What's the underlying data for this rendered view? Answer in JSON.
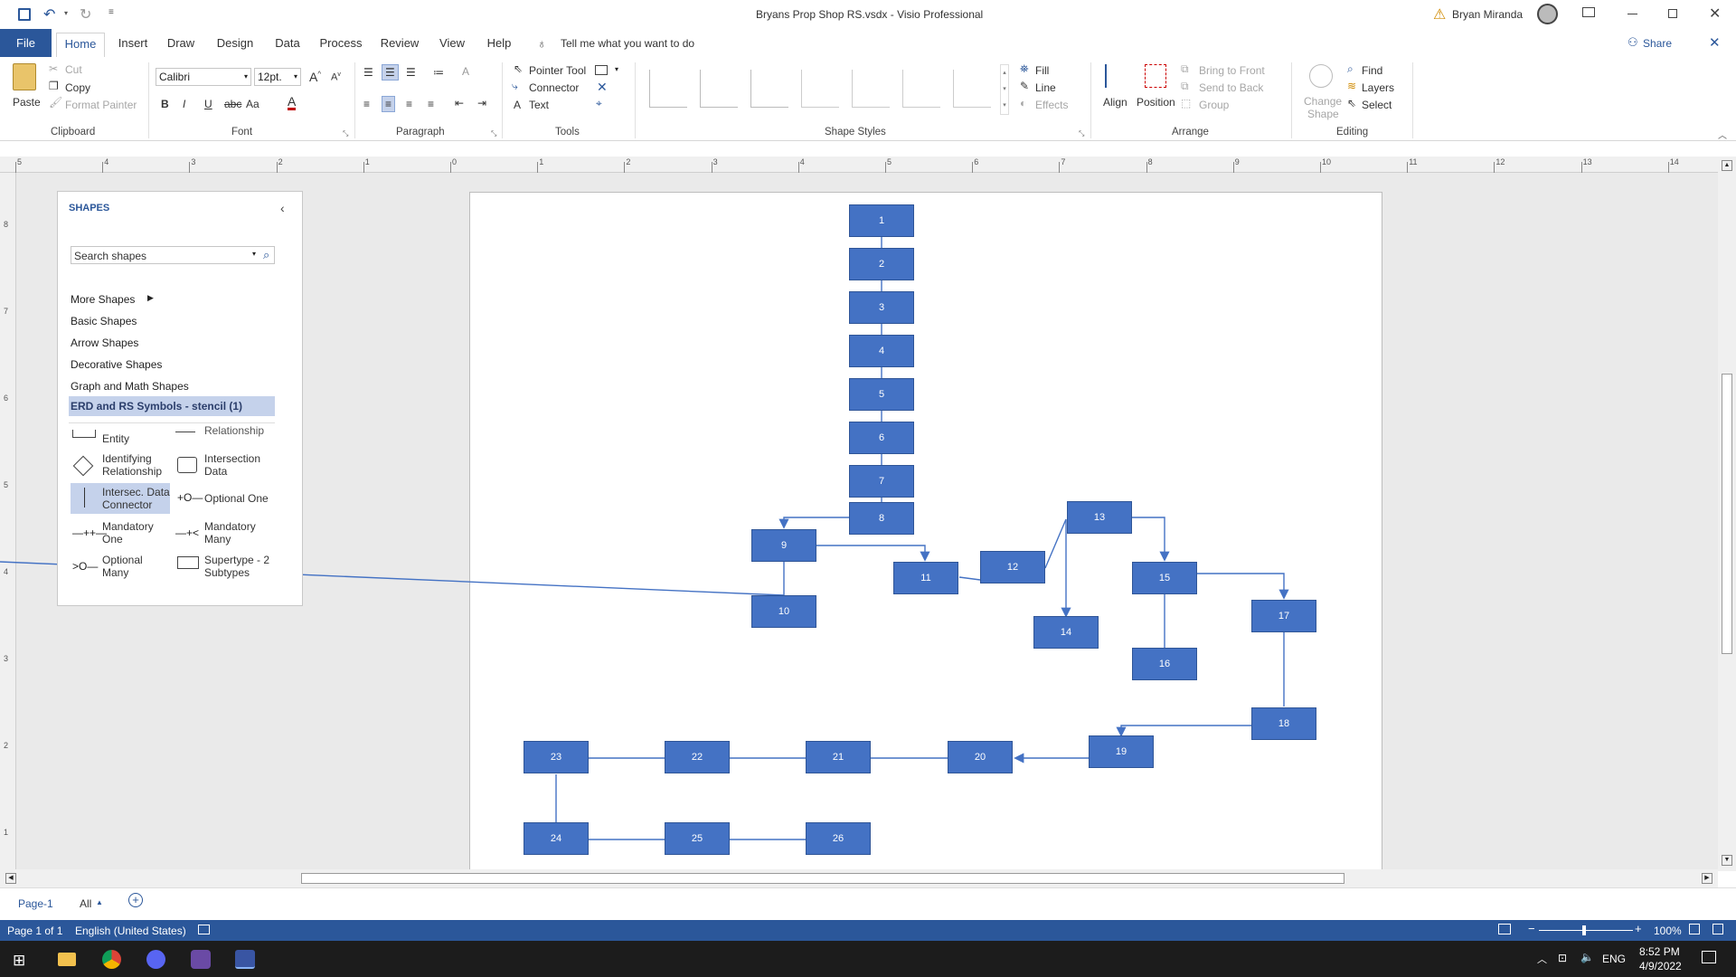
{
  "window": {
    "title": "Bryans Prop Shop RS.vsdx  -  Visio Professional",
    "user": "Bryan Miranda",
    "share": "Share",
    "tell_me": "Tell me what you want to do"
  },
  "tabs": [
    "File",
    "Home",
    "Insert",
    "Draw",
    "Design",
    "Data",
    "Process",
    "Review",
    "View",
    "Help"
  ],
  "ribbon": {
    "clipboard": {
      "paste": "Paste",
      "cut": "Cut",
      "copy": "Copy",
      "format_painter": "Format Painter",
      "label": "Clipboard"
    },
    "font": {
      "family": "Calibri",
      "size": "12pt.",
      "label": "Font",
      "aa": "Aa"
    },
    "paragraph": {
      "label": "Paragraph"
    },
    "tools": {
      "pointer": "Pointer Tool",
      "connector": "Connector",
      "text": "Text",
      "label": "Tools"
    },
    "shape_styles": {
      "fill": "Fill",
      "line": "Line",
      "effects": "Effects",
      "label": "Shape Styles"
    },
    "arrange": {
      "align": "Align",
      "position": "Position",
      "bring_front": "Bring to Front",
      "send_back": "Send to Back",
      "group": "Group",
      "label": "Arrange"
    },
    "editing": {
      "change_shape_1": "Change",
      "change_shape_2": "Shape",
      "find": "Find",
      "layers": "Layers",
      "select": "Select",
      "label": "Editing"
    }
  },
  "ruler_h": [
    "5",
    "4",
    "3",
    "2",
    "1",
    "0",
    "1",
    "2",
    "3",
    "4",
    "5",
    "6",
    "7",
    "8",
    "9",
    "10",
    "11",
    "12",
    "13",
    "14"
  ],
  "ruler_v": [
    "8",
    "7",
    "6",
    "5",
    "4",
    "3",
    "2",
    "1"
  ],
  "shapes_panel": {
    "title": "SHAPES",
    "search_placeholder": "Search shapes",
    "more_shapes": "More Shapes",
    "categories": [
      "Basic Shapes",
      "Arrow Shapes",
      "Decorative Shapes",
      "Graph and Math Shapes"
    ],
    "selected_stencil": "ERD and RS Symbols - stencil (1)",
    "items": [
      {
        "l1": "Entity",
        "l2": ""
      },
      {
        "l1": "Relationship",
        "l2": ""
      },
      {
        "l1": "Identifying",
        "l2": "Relationship"
      },
      {
        "l1": "Intersection",
        "l2": "Data"
      },
      {
        "l1": "Intersec. Data",
        "l2": "Connector"
      },
      {
        "l1": "Optional One",
        "l2": ""
      },
      {
        "l1": "Mandatory",
        "l2": "One"
      },
      {
        "l1": "Mandatory",
        "l2": "Many"
      },
      {
        "l1": "Optional",
        "l2": "Many"
      },
      {
        "l1": "Supertype - 2",
        "l2": "Subtypes"
      }
    ]
  },
  "diagram": {
    "nodes": [
      "1",
      "2",
      "3",
      "4",
      "5",
      "6",
      "7",
      "8",
      "9",
      "10",
      "11",
      "12",
      "13",
      "14",
      "15",
      "16",
      "17",
      "18",
      "19",
      "20",
      "21",
      "22",
      "23",
      "24",
      "25",
      "26"
    ]
  },
  "page_tabs": {
    "current": "Page-1",
    "all": "All"
  },
  "status": {
    "page": "Page 1 of 1",
    "language": "English (United States)",
    "zoom": "100%"
  },
  "taskbar": {
    "lang": "ENG",
    "time": "8:52 PM",
    "date": "4/9/2022"
  }
}
